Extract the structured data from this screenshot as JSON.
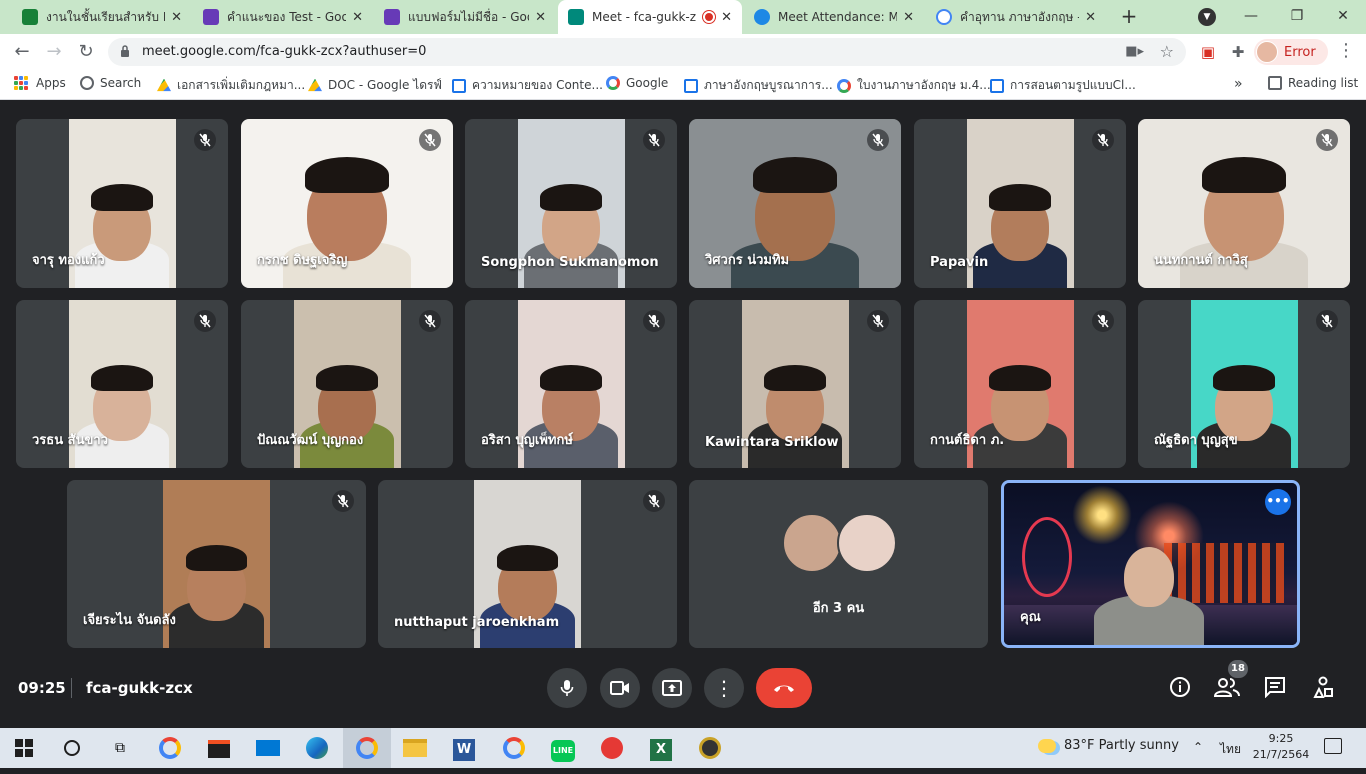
{
  "browser": {
    "tabs": [
      {
        "title": "งานในชั้นเรียนสำหรับ Eng",
        "favicon": "#188038",
        "active": false
      },
      {
        "title": "คำแนะของ Test - Google",
        "favicon": "#673ab7",
        "active": false
      },
      {
        "title": "แบบฟอร์มไม่มีชื่อ - Goog",
        "favicon": "#673ab7",
        "active": false
      },
      {
        "title": "Meet - fca-gukk-z",
        "favicon": "#00897b",
        "active": true
      },
      {
        "title": "Meet Attendance: Mor",
        "favicon": "#1e88e5",
        "active": false
      },
      {
        "title": "คำอุทาน ภาษาอังกฤษ - คำ",
        "favicon": "#4285f4",
        "active": false
      }
    ],
    "url": "meet.google.com/fca-gukk-zcx?authuser=0",
    "profile_label": "Error",
    "bookmarks": [
      {
        "label": "Apps",
        "icon": "apps-icon"
      },
      {
        "label": "Search",
        "icon": "search-icon"
      },
      {
        "label": "เอกสารเพิ่มเติมกฎหมา...",
        "icon": "drive-icon"
      },
      {
        "label": "DOC - Google ไดรฟ์",
        "icon": "drive-icon"
      },
      {
        "label": "ความหมายของ Conte...",
        "icon": "page-icon"
      },
      {
        "label": "Google",
        "icon": "google-icon"
      },
      {
        "label": "ภาษาอังกฤษบูรณาการ...",
        "icon": "page-icon"
      },
      {
        "label": "ใบงานภาษาอังกฤษ ม.4...",
        "icon": "google-icon"
      },
      {
        "label": "การสอนตามรูปแบบCl...",
        "icon": "page-icon"
      }
    ],
    "reading_list": "Reading list"
  },
  "participants": [
    {
      "name": "จารุ ทองแก้ว",
      "bg": "#e8e4dc",
      "skin": "#c99a7a",
      "shirt": "#f0f0f0"
    },
    {
      "name": "กรกช ดิษฐเจริญ",
      "bg": "#f4f2ee",
      "skin": "#b97d5e",
      "shirt": "#e8e2d6"
    },
    {
      "name": "Songphon Sukmanomon",
      "bg": "#cfd4d8",
      "skin": "#d2a587",
      "shirt": "#6b6f74"
    },
    {
      "name": "วิศวกร น่วมทิม",
      "bg": "#8a8f92",
      "skin": "#a4704e",
      "shirt": "#3b4a50"
    },
    {
      "name": "Papavin",
      "bg": "#d9d2c8",
      "skin": "#b27d5c",
      "shirt": "#1f2a44"
    },
    {
      "name": "นนทกานต์ กาวิสุ",
      "bg": "#e9e6e0",
      "skin": "#c79373",
      "shirt": "#d8d3ca"
    },
    {
      "name": "วรธน สันขาว",
      "bg": "#e2ddd2",
      "skin": "#d8b29a",
      "shirt": "#eeeeee"
    },
    {
      "name": "ปัณณวัฒน์ บุญกอง",
      "bg": "#cbbfae",
      "skin": "#a86f4f",
      "shirt": "#7b8a3c"
    },
    {
      "name": "อริสา บุญเพ็ทกษ์",
      "bg": "#e4d7d3",
      "skin": "#b98064",
      "shirt": "#5a5f6b"
    },
    {
      "name": "Kawintara Sriklow",
      "bg": "#c8bcae",
      "skin": "#bf8c6d",
      "shirt": "#2a2a2a"
    },
    {
      "name": "กานต์ธิดา ภ.",
      "bg": "#e07a6e",
      "skin": "#c79373",
      "shirt": "#3b3b3b"
    },
    {
      "name": "ณัฐธิดา บุญสุข",
      "bg": "#47d7c7",
      "skin": "#d2a587",
      "shirt": "#2a2a2a"
    },
    {
      "name": "เจียระไน จันดลัง",
      "bg": "#b07d56",
      "skin": "#b7805e",
      "shirt": "#2c2c2c"
    },
    {
      "name": "nutthaput jaroenkham",
      "bg": "#d8d6d2",
      "skin": "#b47c5a",
      "shirt": "#2c3e70"
    }
  ],
  "more_tile": {
    "label": "อีก 3 คน",
    "avatar_colors": [
      "#caa58e",
      "#e8d2c8"
    ]
  },
  "self_tile": {
    "name": "คุณ"
  },
  "meeting": {
    "time": "09:25",
    "code": "fca-gukk-zcx",
    "participant_count": "18"
  },
  "taskbar": {
    "weather": "83°F  Partly sunny",
    "ime": "ไทย",
    "time": "9:25",
    "date": "21/7/2564"
  },
  "colors": {
    "accent": "#1a73e8",
    "end_call": "#ea4335",
    "tile_bg": "#3c4043",
    "stage_bg": "#202124"
  }
}
